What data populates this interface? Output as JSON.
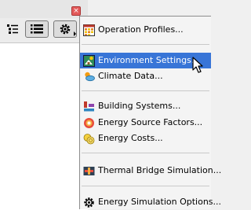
{
  "palette": {
    "close_glyph": "×",
    "toolbar": {
      "tree_view": "tree-view-icon",
      "list_view": "list-view-icon",
      "options": "gear-icon"
    }
  },
  "menu": {
    "items": [
      {
        "label": "Operation Profiles...",
        "icon": "calendar-grid-icon"
      },
      {
        "label": "Environment Settings...",
        "icon": "environment-icon",
        "highlighted": true
      },
      {
        "label": "Climate Data...",
        "icon": "climate-icon"
      },
      {
        "label": "Building Systems...",
        "icon": "building-systems-icon"
      },
      {
        "label": "Energy Source Factors...",
        "icon": "energy-source-icon"
      },
      {
        "label": "Energy Costs...",
        "icon": "coins-icon"
      },
      {
        "label": "Thermal Bridge Simulation...",
        "icon": "thermal-bridge-icon"
      },
      {
        "label": "Energy Simulation Options...",
        "icon": "gear-icon"
      }
    ]
  },
  "colors": {
    "highlight": "#3875d7",
    "menu_bg": "#f4f4f4"
  }
}
